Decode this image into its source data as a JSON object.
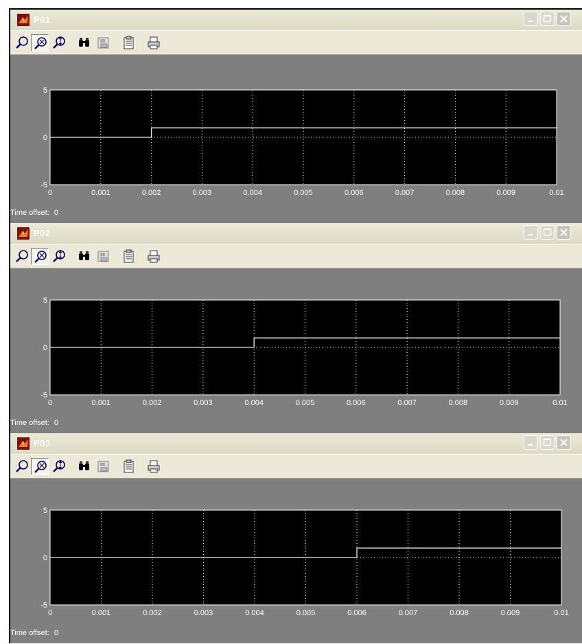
{
  "windows": [
    {
      "title": "P01",
      "time_offset_label": "Time offset:",
      "time_offset_value": "0"
    },
    {
      "title": "P02",
      "time_offset_label": "Time offset:",
      "time_offset_value": "0"
    },
    {
      "title": "P03",
      "time_offset_label": "Time offset:",
      "time_offset_value": "0"
    }
  ],
  "toolbar": {
    "buttons": [
      "zoom-in",
      "zoom-xy",
      "zoom-y",
      "autoscale",
      "save-axes",
      "scope-params",
      "print"
    ]
  },
  "colors": {
    "plot_background": "#000000",
    "figure_background": "#7f7f7f",
    "signal": "#f0f0c0",
    "grid": "#ffffff",
    "title_text": "#ffffff",
    "close_button": "#c8c5bb"
  },
  "chart_data": [
    {
      "type": "line",
      "x": [
        0,
        0.002,
        0.002,
        0.01
      ],
      "y": [
        0,
        0,
        1,
        1
      ],
      "xlim": [
        0,
        0.01
      ],
      "ylim": [
        -5,
        5
      ],
      "xticks": [
        "0",
        "0.001",
        "0.002",
        "0.003",
        "0.004",
        "0.005",
        "0.006",
        "0.007",
        "0.008",
        "0.009",
        "0.01"
      ],
      "yticks": [
        "5",
        "0",
        "-5"
      ],
      "grid": true
    },
    {
      "type": "line",
      "x": [
        0,
        0.004,
        0.004,
        0.01
      ],
      "y": [
        0,
        0,
        1,
        1
      ],
      "xlim": [
        0,
        0.01
      ],
      "ylim": [
        -5,
        5
      ],
      "xticks": [
        "0",
        "0.001",
        "0.002",
        "0.003",
        "0.004",
        "0.005",
        "0.006",
        "0.007",
        "0.008",
        "0.009",
        "0.01"
      ],
      "yticks": [
        "5",
        "0",
        "-5"
      ],
      "grid": true
    },
    {
      "type": "line",
      "x": [
        0,
        0.006,
        0.006,
        0.01
      ],
      "y": [
        0,
        0,
        1,
        1
      ],
      "xlim": [
        0,
        0.01
      ],
      "ylim": [
        -5,
        5
      ],
      "xticks": [
        "0",
        "0.001",
        "0.002",
        "0.003",
        "0.004",
        "0.005",
        "0.006",
        "0.007",
        "0.008",
        "0.009",
        "0.01"
      ],
      "yticks": [
        "5",
        "0",
        "-5"
      ],
      "grid": true
    }
  ]
}
